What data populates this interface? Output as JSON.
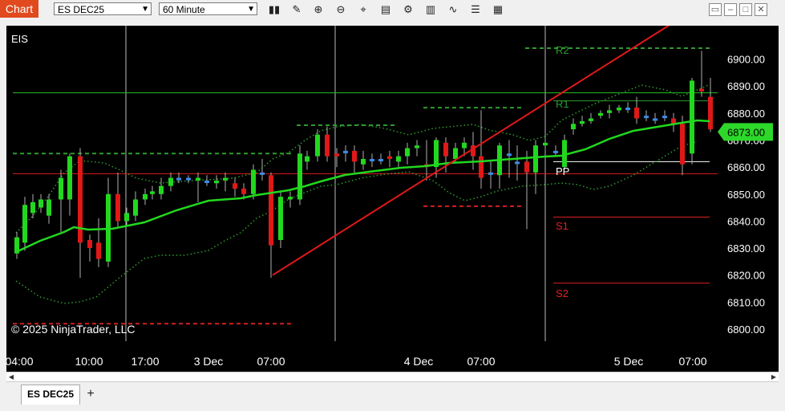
{
  "toolbar": {
    "chart_tab": "Chart",
    "instrument": "ES DEC25",
    "interval": "60 Minute",
    "tools": [
      "bar-type-icon",
      "draw-tool-icon",
      "zoom-in-icon",
      "zoom-out-icon",
      "crosshair-icon",
      "data-box-icon",
      "indicators-icon",
      "strategies-icon",
      "chart-trader-icon",
      "properties-icon"
    ],
    "window_buttons": [
      "restore-icon",
      "minimize-icon",
      "maximize-icon",
      "close-icon"
    ]
  },
  "chart": {
    "symbol_label": "EIS",
    "copyright": "© 2025 NinjaTrader, LLC",
    "price_badge": "6873.00",
    "colors": {
      "up": "#22d81e",
      "down": "#e01818",
      "flat": "#3c8ce6",
      "sma": "#22d81e",
      "pivot_green": "#2e9a2e",
      "pivot_red": "#e02020",
      "trend": "#e01818"
    },
    "pivot_labels": [
      {
        "text": "R2",
        "color": "green"
      },
      {
        "text": "R1",
        "color": "green"
      },
      {
        "text": "PP",
        "color": "white"
      },
      {
        "text": "S1",
        "color": "red"
      },
      {
        "text": "S2",
        "color": "red"
      }
    ]
  },
  "chart_data": {
    "type": "candlestick",
    "y_ticks": [
      "6900.00",
      "6890.00",
      "6880.00",
      "6870.00",
      "6860.00",
      "6850.00",
      "6840.00",
      "6830.00",
      "6820.00",
      "6810.00",
      "6800.00"
    ],
    "x_ticks": [
      "04:00",
      "10:00",
      "17:00",
      "3 Dec",
      "07:00",
      "4 Dec",
      "07:00",
      "5 Dec",
      "07:00"
    ],
    "ylim": [
      6796,
      6910
    ],
    "last_price": 6873.0,
    "pivots": {
      "R2": 6904,
      "R1": 6884.5,
      "PP": 6862,
      "S1": 6841.5,
      "S2": 6817
    },
    "horizontal_lines": [
      6887.5,
      6857.5
    ]
  },
  "tabs": {
    "active": "ES DEC25",
    "add": "+"
  }
}
